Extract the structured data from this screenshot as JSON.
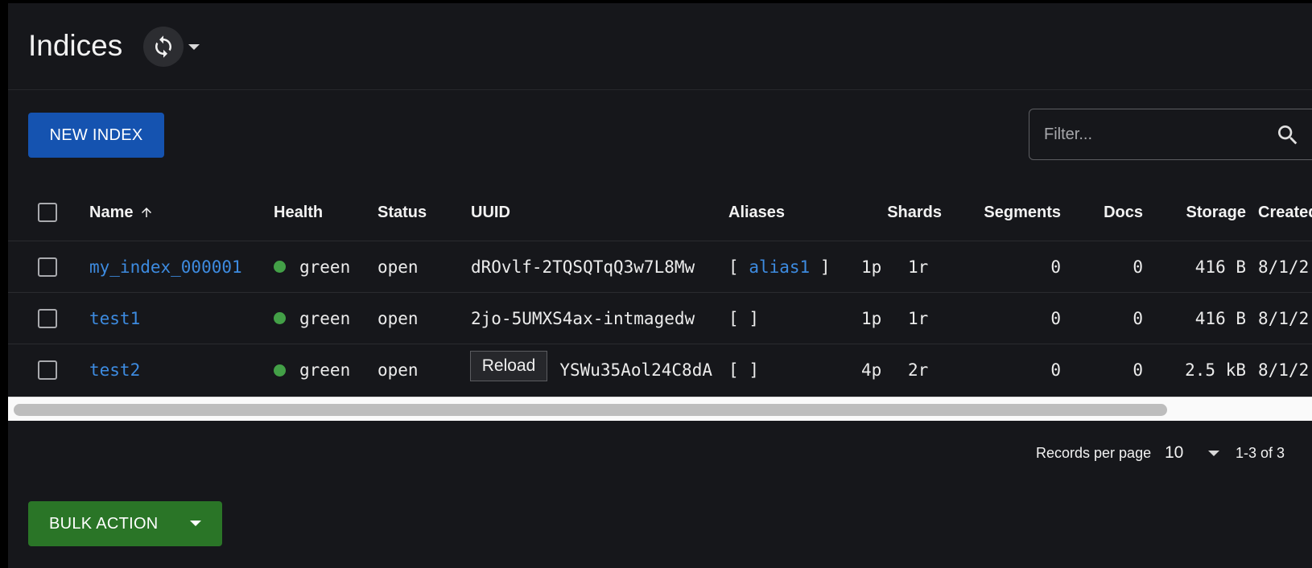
{
  "header": {
    "title": "Indices",
    "reload_icon": "refresh-icon",
    "menu_icon": "caret-down-icon"
  },
  "toolbar": {
    "new_index_label": "NEW INDEX",
    "filter_placeholder": "Filter...",
    "search_icon": "search-icon"
  },
  "table": {
    "columns": {
      "name": "Name",
      "health": "Health",
      "status": "Status",
      "uuid": "UUID",
      "aliases": "Aliases",
      "shards": "Shards",
      "segments": "Segments",
      "docs": "Docs",
      "storage": "Storage",
      "created": "Created"
    },
    "sort": {
      "column": "name",
      "direction": "ascending"
    },
    "rows": [
      {
        "name": "my_index_000001",
        "health": "green",
        "status": "open",
        "uuid": "dROvlf-2TQSQTqQ3w7L8Mw",
        "alias_open": "[",
        "alias": "alias1",
        "alias_close": "]",
        "shards_p": "1p",
        "shards_r": "1r",
        "segments": "0",
        "docs": "0",
        "storage": "416 B",
        "created": "8/1/2"
      },
      {
        "name": "test1",
        "health": "green",
        "status": "open",
        "uuid": "2jo-5UMXS4ax-intmagedw",
        "alias_open": "[",
        "alias": "",
        "alias_close": "]",
        "shards_p": "1p",
        "shards_r": "1r",
        "segments": "0",
        "docs": "0",
        "storage": "416 B",
        "created": "8/1/2"
      },
      {
        "name": "test2",
        "health": "green",
        "status": "open",
        "uuid": "YSWu35Aol24C8dA",
        "alias_open": "[",
        "alias": "",
        "alias_close": "]",
        "shards_p": "4p",
        "shards_r": "2r",
        "segments": "0",
        "docs": "0",
        "storage": "2.5 kB",
        "created": "8/1/2"
      }
    ]
  },
  "tooltip": {
    "text": "Reload"
  },
  "pagination": {
    "records_per_page_label": "Records per page",
    "records_per_page_value": "10",
    "range": "1-3 of 3"
  },
  "footer": {
    "bulk_action_label": "BULK ACTION"
  },
  "colors": {
    "background": "#16171b",
    "primary": "#1553b0",
    "success": "#2a7527",
    "link": "#3d8be0",
    "health_green": "#43a047"
  }
}
